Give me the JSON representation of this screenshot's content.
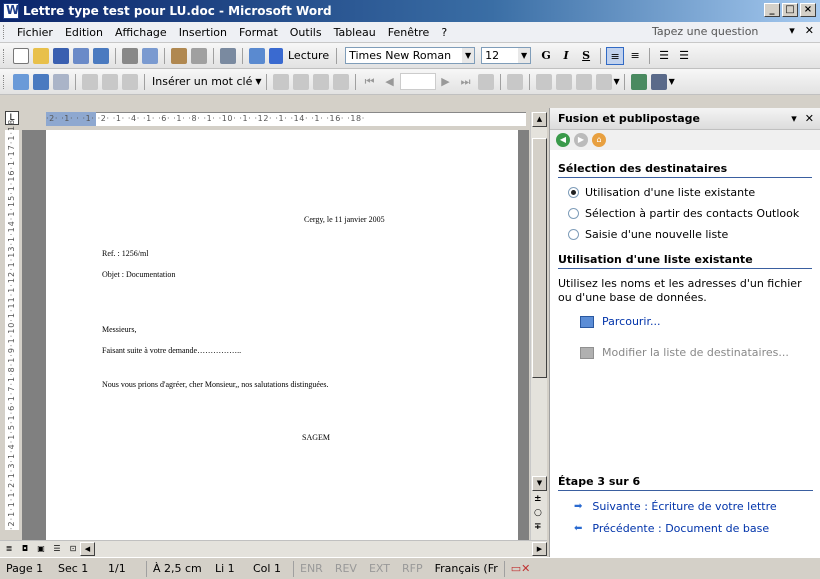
{
  "window": {
    "title": "Lettre type test pour LU.doc - Microsoft Word",
    "buttons": [
      "_",
      "□",
      "×"
    ]
  },
  "menubar": {
    "items": [
      "Fichier",
      "Edition",
      "Affichage",
      "Insertion",
      "Format",
      "Outils",
      "Tableau",
      "Fenêtre",
      "?"
    ],
    "question_placeholder": "Tapez une question"
  },
  "toolbar1": {
    "read_label": "Lecture",
    "font": "Times New Roman",
    "size": "12",
    "bold": "G",
    "italic": "I",
    "underline": "S"
  },
  "toolbar2": {
    "insert_field_label": "Insérer un mot clé"
  },
  "ruler": {
    "h_ticks": "·2· ·1· · ·1· ·2· ·1· ·4· ·1· ·6· ·1· ·8· ·1· ·10· ·1· ·12· ·1· ·14· ·1· ·16· ·18·",
    "v_ticks": "·2·1·1·1·2·1·3·1·4·1·5·1·6·1·7·1·8·1·9·1·10·1·11·1·12·1·13·1·14·1·15·1·16·1·17·1·18"
  },
  "document": {
    "date_line": "Cergy, le 11 janvier 2005",
    "ref_line": "Ref. : 1256/ml",
    "objet_line": "Objet : Documentation",
    "salutation": "Messieurs,",
    "line1": "Faisant suite à votre demande……………..",
    "line2": "Nous vous prions d'agréer, cher Monsieur,, nos salutations distinguées.",
    "signature": "SAGEM"
  },
  "taskpane": {
    "title": "Fusion et publipostage",
    "section1": "Sélection des destinataires",
    "options": [
      {
        "label": "Utilisation d'une liste existante",
        "selected": true
      },
      {
        "label": "Sélection à partir des contacts Outlook",
        "selected": false
      },
      {
        "label": "Saisie d'une nouvelle liste",
        "selected": false
      }
    ],
    "section2": "Utilisation d'une liste existante",
    "description": "Utilisez les noms et les adresses d'un fichier ou d'une base de données.",
    "browse_link": "Parcourir...",
    "modify_link": "Modifier la liste de destinataires...",
    "step": "Étape 3 sur 6",
    "next_link": "Suivante : Écriture de votre lettre",
    "prev_link": "Précédente : Document de base"
  },
  "status": {
    "page": "Page 1",
    "sec": "Sec 1",
    "pages": "1/1",
    "at": "À 2,5 cm",
    "line": "Li 1",
    "col": "Col 1",
    "enr": "ENR",
    "rev": "REV",
    "ext": "EXT",
    "rfp": "RFP",
    "lang": "Français (Fr"
  }
}
